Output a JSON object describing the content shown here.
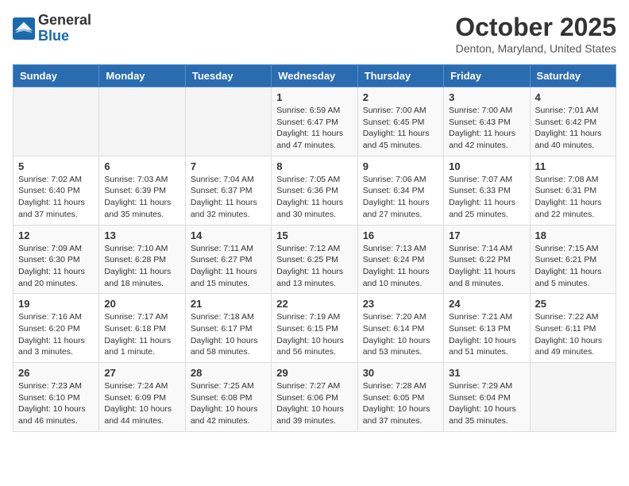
{
  "logo": {
    "general": "General",
    "blue": "Blue"
  },
  "header": {
    "month": "October 2025",
    "location": "Denton, Maryland, United States"
  },
  "weekdays": [
    "Sunday",
    "Monday",
    "Tuesday",
    "Wednesday",
    "Thursday",
    "Friday",
    "Saturday"
  ],
  "weeks": [
    [
      {
        "day": "",
        "info": ""
      },
      {
        "day": "",
        "info": ""
      },
      {
        "day": "",
        "info": ""
      },
      {
        "day": "1",
        "info": "Sunrise: 6:59 AM\nSunset: 6:47 PM\nDaylight: 11 hours and 47 minutes."
      },
      {
        "day": "2",
        "info": "Sunrise: 7:00 AM\nSunset: 6:45 PM\nDaylight: 11 hours and 45 minutes."
      },
      {
        "day": "3",
        "info": "Sunrise: 7:00 AM\nSunset: 6:43 PM\nDaylight: 11 hours and 42 minutes."
      },
      {
        "day": "4",
        "info": "Sunrise: 7:01 AM\nSunset: 6:42 PM\nDaylight: 11 hours and 40 minutes."
      }
    ],
    [
      {
        "day": "5",
        "info": "Sunrise: 7:02 AM\nSunset: 6:40 PM\nDaylight: 11 hours and 37 minutes."
      },
      {
        "day": "6",
        "info": "Sunrise: 7:03 AM\nSunset: 6:39 PM\nDaylight: 11 hours and 35 minutes."
      },
      {
        "day": "7",
        "info": "Sunrise: 7:04 AM\nSunset: 6:37 PM\nDaylight: 11 hours and 32 minutes."
      },
      {
        "day": "8",
        "info": "Sunrise: 7:05 AM\nSunset: 6:36 PM\nDaylight: 11 hours and 30 minutes."
      },
      {
        "day": "9",
        "info": "Sunrise: 7:06 AM\nSunset: 6:34 PM\nDaylight: 11 hours and 27 minutes."
      },
      {
        "day": "10",
        "info": "Sunrise: 7:07 AM\nSunset: 6:33 PM\nDaylight: 11 hours and 25 minutes."
      },
      {
        "day": "11",
        "info": "Sunrise: 7:08 AM\nSunset: 6:31 PM\nDaylight: 11 hours and 22 minutes."
      }
    ],
    [
      {
        "day": "12",
        "info": "Sunrise: 7:09 AM\nSunset: 6:30 PM\nDaylight: 11 hours and 20 minutes."
      },
      {
        "day": "13",
        "info": "Sunrise: 7:10 AM\nSunset: 6:28 PM\nDaylight: 11 hours and 18 minutes."
      },
      {
        "day": "14",
        "info": "Sunrise: 7:11 AM\nSunset: 6:27 PM\nDaylight: 11 hours and 15 minutes."
      },
      {
        "day": "15",
        "info": "Sunrise: 7:12 AM\nSunset: 6:25 PM\nDaylight: 11 hours and 13 minutes."
      },
      {
        "day": "16",
        "info": "Sunrise: 7:13 AM\nSunset: 6:24 PM\nDaylight: 11 hours and 10 minutes."
      },
      {
        "day": "17",
        "info": "Sunrise: 7:14 AM\nSunset: 6:22 PM\nDaylight: 11 hours and 8 minutes."
      },
      {
        "day": "18",
        "info": "Sunrise: 7:15 AM\nSunset: 6:21 PM\nDaylight: 11 hours and 5 minutes."
      }
    ],
    [
      {
        "day": "19",
        "info": "Sunrise: 7:16 AM\nSunset: 6:20 PM\nDaylight: 11 hours and 3 minutes."
      },
      {
        "day": "20",
        "info": "Sunrise: 7:17 AM\nSunset: 6:18 PM\nDaylight: 11 hours and 1 minute."
      },
      {
        "day": "21",
        "info": "Sunrise: 7:18 AM\nSunset: 6:17 PM\nDaylight: 10 hours and 58 minutes."
      },
      {
        "day": "22",
        "info": "Sunrise: 7:19 AM\nSunset: 6:15 PM\nDaylight: 10 hours and 56 minutes."
      },
      {
        "day": "23",
        "info": "Sunrise: 7:20 AM\nSunset: 6:14 PM\nDaylight: 10 hours and 53 minutes."
      },
      {
        "day": "24",
        "info": "Sunrise: 7:21 AM\nSunset: 6:13 PM\nDaylight: 10 hours and 51 minutes."
      },
      {
        "day": "25",
        "info": "Sunrise: 7:22 AM\nSunset: 6:11 PM\nDaylight: 10 hours and 49 minutes."
      }
    ],
    [
      {
        "day": "26",
        "info": "Sunrise: 7:23 AM\nSunset: 6:10 PM\nDaylight: 10 hours and 46 minutes."
      },
      {
        "day": "27",
        "info": "Sunrise: 7:24 AM\nSunset: 6:09 PM\nDaylight: 10 hours and 44 minutes."
      },
      {
        "day": "28",
        "info": "Sunrise: 7:25 AM\nSunset: 6:08 PM\nDaylight: 10 hours and 42 minutes."
      },
      {
        "day": "29",
        "info": "Sunrise: 7:27 AM\nSunset: 6:06 PM\nDaylight: 10 hours and 39 minutes."
      },
      {
        "day": "30",
        "info": "Sunrise: 7:28 AM\nSunset: 6:05 PM\nDaylight: 10 hours and 37 minutes."
      },
      {
        "day": "31",
        "info": "Sunrise: 7:29 AM\nSunset: 6:04 PM\nDaylight: 10 hours and 35 minutes."
      },
      {
        "day": "",
        "info": ""
      }
    ]
  ]
}
